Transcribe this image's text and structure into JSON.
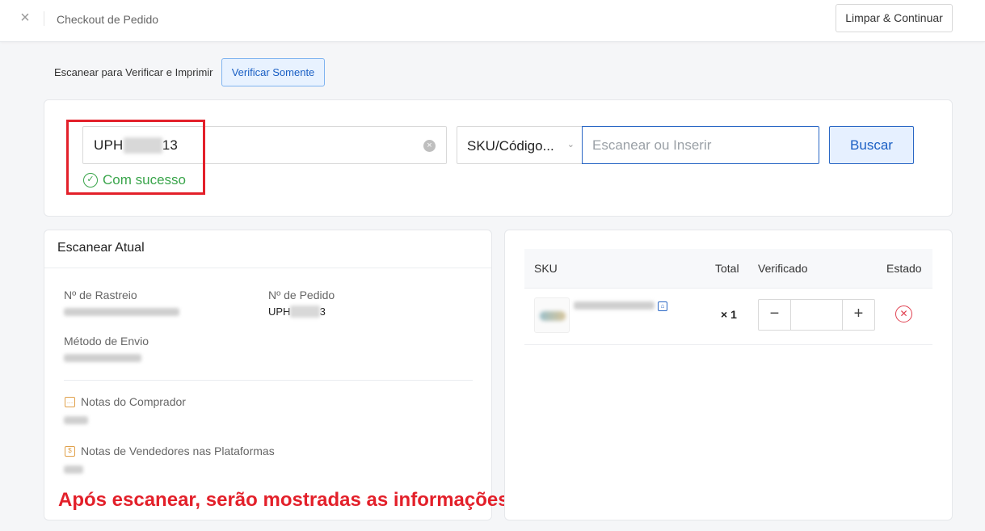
{
  "header": {
    "close_icon": "close-icon",
    "title": "Checkout de Pedido",
    "clear_button": "Limpar & Continuar"
  },
  "modes": {
    "scan_verify_print": "Escanear para Verificar e Imprimir",
    "verify_only": "Verificar Somente",
    "active": "verify_only"
  },
  "search": {
    "order_prefix": "UPH",
    "order_hidden": "00000",
    "order_suffix": "13",
    "clear_icon": "clear-circle-icon",
    "status": "Com sucesso",
    "status_icon": "check-circle-icon",
    "type_select": "SKU/Código...",
    "scan_placeholder": "Escanear ou Inserir",
    "search_button": "Buscar"
  },
  "current_scan": {
    "heading": "Escanear Atual",
    "tracking_label": "Nº de Rastreio",
    "order_label": "Nº de Pedido",
    "order_prefix": "UPH",
    "order_hidden": "00000",
    "order_suffix": "3",
    "shipping_label": "Método de Envio",
    "buyer_notes_label": "Notas do Comprador",
    "seller_notes_label": "Notas de Vendedores nas Plataformas"
  },
  "sku_table": {
    "columns": [
      "SKU",
      "Total",
      "Verificado",
      "Estado"
    ],
    "rows": [
      {
        "quantity": "× 1",
        "verified": ""
      }
    ]
  },
  "caption": "Após escanear, serão mostradas as informações do pedido",
  "colors": {
    "accent": "#2a67c5",
    "success": "#3aa54b",
    "highlight": "#e3202a"
  }
}
